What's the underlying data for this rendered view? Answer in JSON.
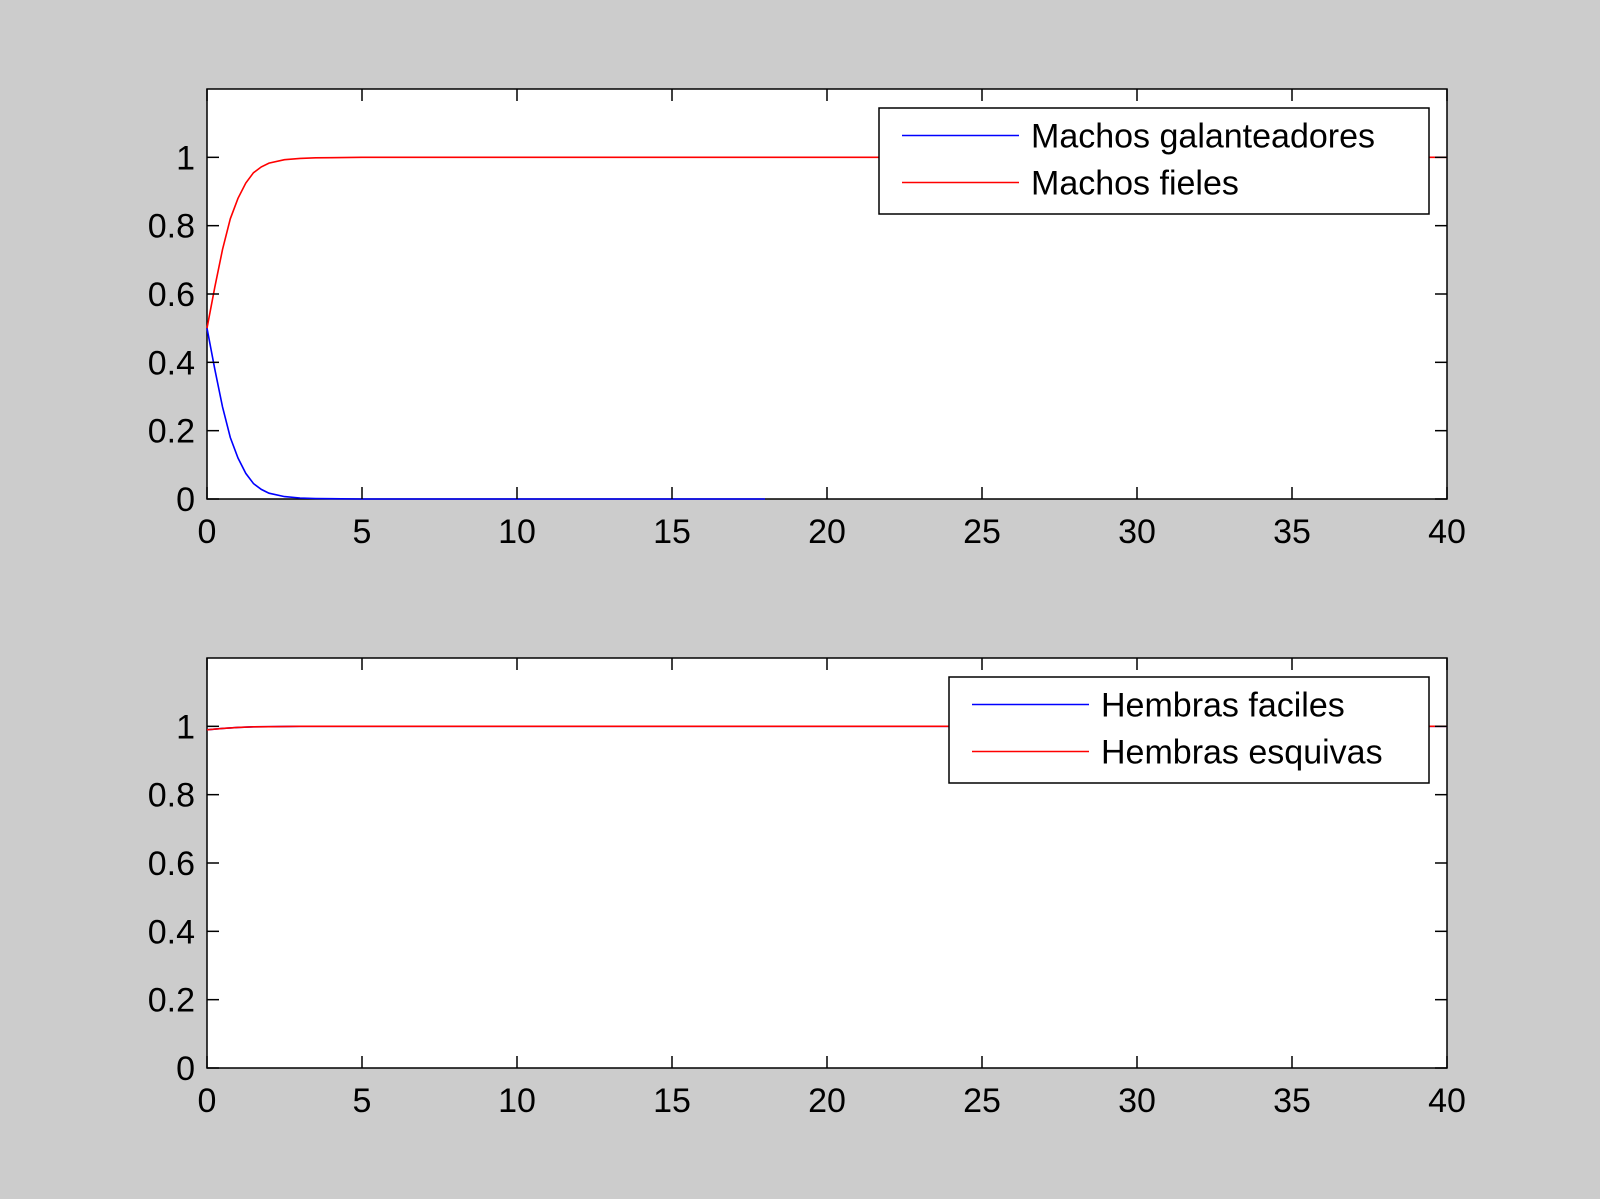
{
  "figure": {
    "background": "#cccccc"
  },
  "chart_data": [
    {
      "type": "line",
      "xlim": [
        0,
        40
      ],
      "ylim": [
        0,
        1.2
      ],
      "xticks": [
        0,
        5,
        10,
        15,
        20,
        25,
        30,
        35,
        40
      ],
      "xtick_labels": [
        "0",
        "5",
        "10",
        "15",
        "20",
        "25",
        "30",
        "35",
        "40"
      ],
      "yticks": [
        0,
        0.2,
        0.4,
        0.6,
        0.8,
        1
      ],
      "ytick_labels": [
        "0",
        "0.2",
        "0.4",
        "0.6",
        "0.8",
        "1"
      ],
      "grid": false,
      "legend_position": "top-right",
      "series": [
        {
          "name": "Machos galanteadores",
          "color": "#0000ff",
          "x": [
            0,
            0.25,
            0.5,
            0.75,
            1,
            1.25,
            1.5,
            1.75,
            2,
            2.5,
            3,
            3.5,
            4,
            5,
            6,
            8,
            10,
            12,
            14,
            16,
            18
          ],
          "y": [
            0.5,
            0.38,
            0.27,
            0.18,
            0.12,
            0.075,
            0.045,
            0.028,
            0.017,
            0.007,
            0.003,
            0.0015,
            0.001,
            0,
            0,
            0,
            0,
            0,
            0,
            0,
            0
          ]
        },
        {
          "name": "Machos fieles",
          "color": "#ff0000",
          "x": [
            0,
            0.25,
            0.5,
            0.75,
            1,
            1.25,
            1.5,
            1.75,
            2,
            2.5,
            3,
            3.5,
            4,
            5,
            6,
            10,
            15,
            20,
            25,
            30,
            35,
            40
          ],
          "y": [
            0.5,
            0.62,
            0.73,
            0.82,
            0.88,
            0.925,
            0.955,
            0.972,
            0.983,
            0.993,
            0.997,
            0.9985,
            0.999,
            1,
            1,
            1,
            1,
            1,
            1,
            1,
            1,
            1
          ]
        }
      ]
    },
    {
      "type": "line",
      "xlim": [
        0,
        40
      ],
      "ylim": [
        0,
        1.2
      ],
      "xticks": [
        0,
        5,
        10,
        15,
        20,
        25,
        30,
        35,
        40
      ],
      "xtick_labels": [
        "0",
        "5",
        "10",
        "15",
        "20",
        "25",
        "30",
        "35",
        "40"
      ],
      "yticks": [
        0,
        0.2,
        0.4,
        0.6,
        0.8,
        1
      ],
      "ytick_labels": [
        "0",
        "0.2",
        "0.4",
        "0.6",
        "0.8",
        "1"
      ],
      "grid": false,
      "legend_position": "top-right",
      "series": [
        {
          "name": "Hembras faciles",
          "color": "#0000ff",
          "x": [
            0,
            0.5,
            1,
            1.5,
            2,
            3,
            4,
            6,
            10,
            20,
            30,
            40
          ],
          "y": [
            0.99,
            0.994,
            0.997,
            0.9985,
            0.999,
            1,
            1,
            1,
            1,
            1,
            1,
            1
          ]
        },
        {
          "name": "Hembras esquivas",
          "color": "#ff0000",
          "x": [
            0,
            0.5,
            1,
            1.5,
            2,
            3,
            4,
            6,
            10,
            20,
            30,
            40
          ],
          "y": [
            0.99,
            0.994,
            0.997,
            0.9985,
            0.999,
            1,
            1,
            1,
            1,
            1,
            1,
            1
          ]
        }
      ]
    }
  ]
}
